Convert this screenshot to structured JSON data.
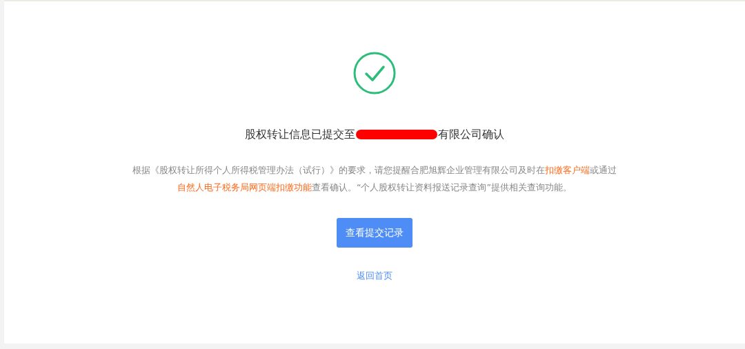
{
  "result": {
    "kind": "success",
    "title": {
      "before": "股权转让信息已提交至",
      "redacted": true,
      "after": "有限公司确认"
    },
    "description": [
      {
        "kind": "text",
        "text": "根据《股权转让所得个人所得税管理办法（试行）》的要求，请您提醒合肥旭辉企业管理有限公司及时在"
      },
      {
        "kind": "link",
        "text": "扣缴客户端"
      },
      {
        "kind": "text",
        "text": "或通过"
      },
      {
        "kind": "link",
        "text": "自然人电子税务局网页端扣缴功能"
      },
      {
        "kind": "text",
        "text": "查看确认。“个人股权转让资料报送记录查询”提供相关查询功能。"
      }
    ],
    "primary_button": "查看提交记录",
    "back_link": "返回首页"
  }
}
